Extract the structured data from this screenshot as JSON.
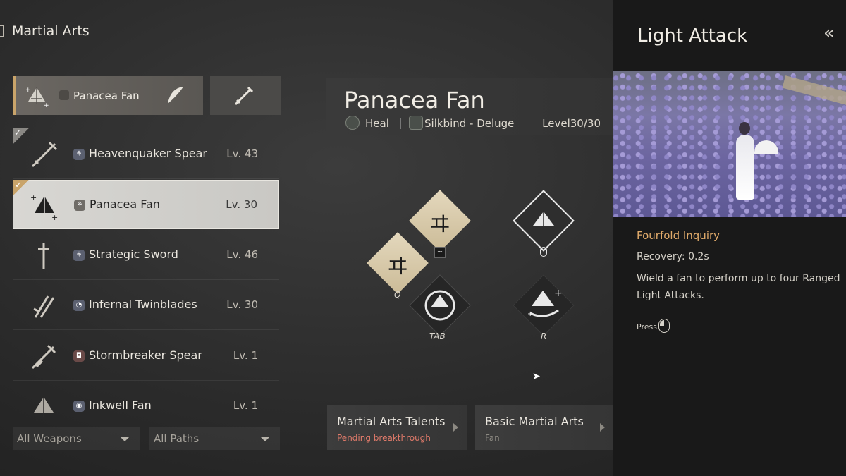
{
  "header": {
    "title": "Martial Arts"
  },
  "equipped": {
    "main_label": "Panacea Fan"
  },
  "weapons": [
    {
      "name": "Heavenquaker Spear",
      "level": "Lv. 43"
    },
    {
      "name": "Panacea Fan",
      "level": "Lv. 30"
    },
    {
      "name": "Strategic Sword",
      "level": "Lv. 46"
    },
    {
      "name": "Infernal Twinblades",
      "level": "Lv. 30"
    },
    {
      "name": "Stormbreaker Spear",
      "level": "Lv. 1"
    },
    {
      "name": "Inkwell Fan",
      "level": "Lv. 1"
    }
  ],
  "filters": {
    "weapons": "All Weapons",
    "paths": "All Paths"
  },
  "detail": {
    "title": "Panacea Fan",
    "tag_heal": "Heal",
    "tag_path": "Silkbind - Deluge",
    "level": "Level30/30"
  },
  "skills": {
    "key_q": "Q",
    "key_tab": "TAB",
    "key_r": "R",
    "key_tilde": "~"
  },
  "buttons": {
    "talents_label": "Martial Arts Talents",
    "talents_status": "Pending breakthrough",
    "basic_label": "Basic Martial Arts",
    "basic_sub": "Fan"
  },
  "right_panel": {
    "title": "Light Attack",
    "subtitle": "Fourfold Inquiry",
    "recovery": "Recovery: 0.2s",
    "description": "Wield a fan to perform up to four Ranged Light Attacks.",
    "press_label": "Press"
  },
  "colors": {
    "accent_gold": "#c9a46a",
    "talent_warning": "#e07a6a",
    "subtitle_orange": "#e0aa6a"
  }
}
